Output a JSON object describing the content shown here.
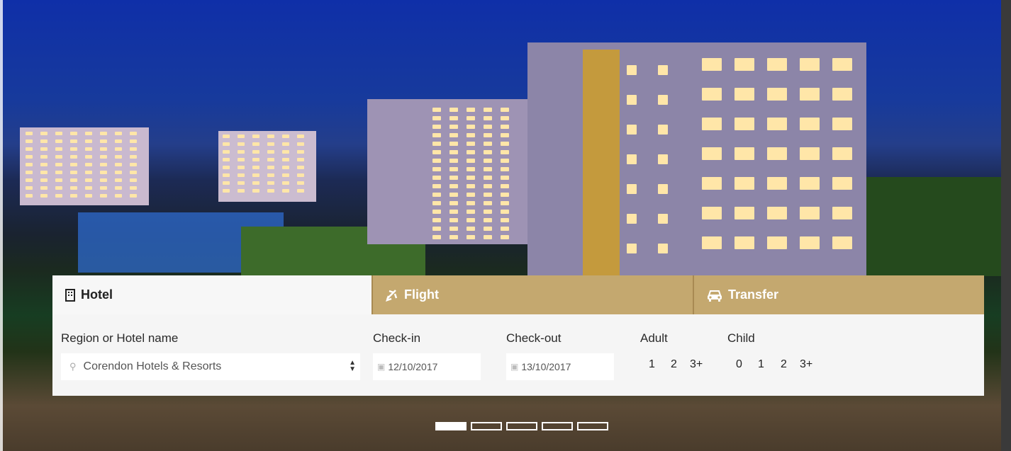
{
  "tabs": [
    {
      "label": "Hotel",
      "icon": "building-icon",
      "active": true
    },
    {
      "label": "Flight",
      "icon": "plane-icon",
      "active": false
    },
    {
      "label": "Transfer",
      "icon": "car-icon",
      "active": false
    }
  ],
  "search": {
    "region_label": "Region or Hotel name",
    "region_value": "Corendon Hotels & Resorts",
    "checkin_label": "Check-in",
    "checkin_value": "12/10/2017",
    "checkout_label": "Check-out",
    "checkout_value": "13/10/2017",
    "adult_label": "Adult",
    "adult_options": [
      "1",
      "2",
      "3+"
    ],
    "child_label": "Child",
    "child_options": [
      "0",
      "1",
      "2",
      "3+"
    ]
  },
  "slider": {
    "count": 5,
    "active_index": 0
  },
  "colors": {
    "tab_inactive": "#c4a86f",
    "panel": "#f5f5f5"
  }
}
